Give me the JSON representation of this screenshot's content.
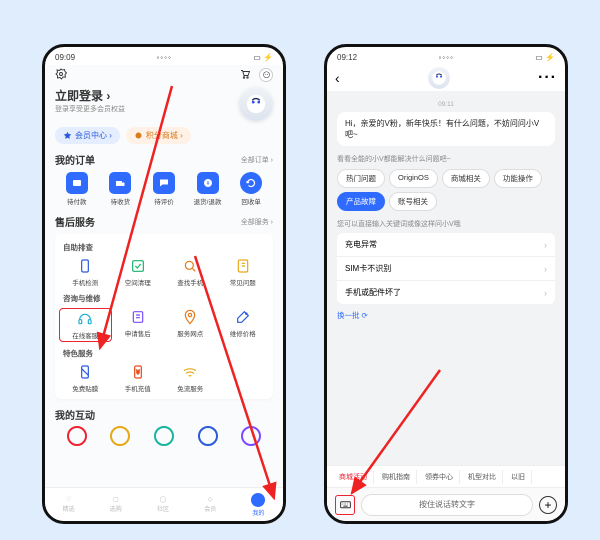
{
  "left": {
    "status_time": "09:09",
    "login_title": "立即登录 ›",
    "login_sub": "登录享受更多会员权益",
    "chip_member": "会员中心 ›",
    "chip_points": "积分商城 ›",
    "orders_title": "我的订单",
    "orders_more": "全部订单 ›",
    "orders": [
      "待付款",
      "待收货",
      "待评价",
      "退货/退款",
      "回收单"
    ],
    "after_title": "售后服务",
    "after_more": "全部服务 ›",
    "group_self": "自助排查",
    "self_items": [
      "手机检测",
      "空间清理",
      "查找手机",
      "常见问题"
    ],
    "group_consult": "咨询与维修",
    "consult_items": [
      "在线客服",
      "申请售后",
      "服务网点",
      "维修价格"
    ],
    "group_special": "特色服务",
    "special_items": [
      "免费贴膜",
      "手机充值",
      "免流服务"
    ],
    "interact_title": "我的互动",
    "tabs": [
      "精选",
      "选购",
      "社区",
      "会员",
      "我的"
    ]
  },
  "right": {
    "status_time": "09:12",
    "chat_time": "09:11",
    "greeting": "Hi，亲爱的V粉，新年快乐！有什么问题，不妨问问小V吧~",
    "hint_cat": "看看全能的小V都能解决什么问题吧~",
    "cats": [
      "热门问题",
      "OriginOS",
      "商城相关",
      "功能操作",
      "产品故障",
      "账号相关"
    ],
    "hint_direct": "您可以直接输入关键词或像这样问小V哦",
    "questions": [
      "充电异常",
      "SIM卡不识别",
      "手机或配件坏了"
    ],
    "refresh": "换一批",
    "quick": [
      "商城活动",
      "购机指南",
      "领券中心",
      "机型对比",
      "以旧"
    ],
    "voice": "按住说话转文字"
  }
}
